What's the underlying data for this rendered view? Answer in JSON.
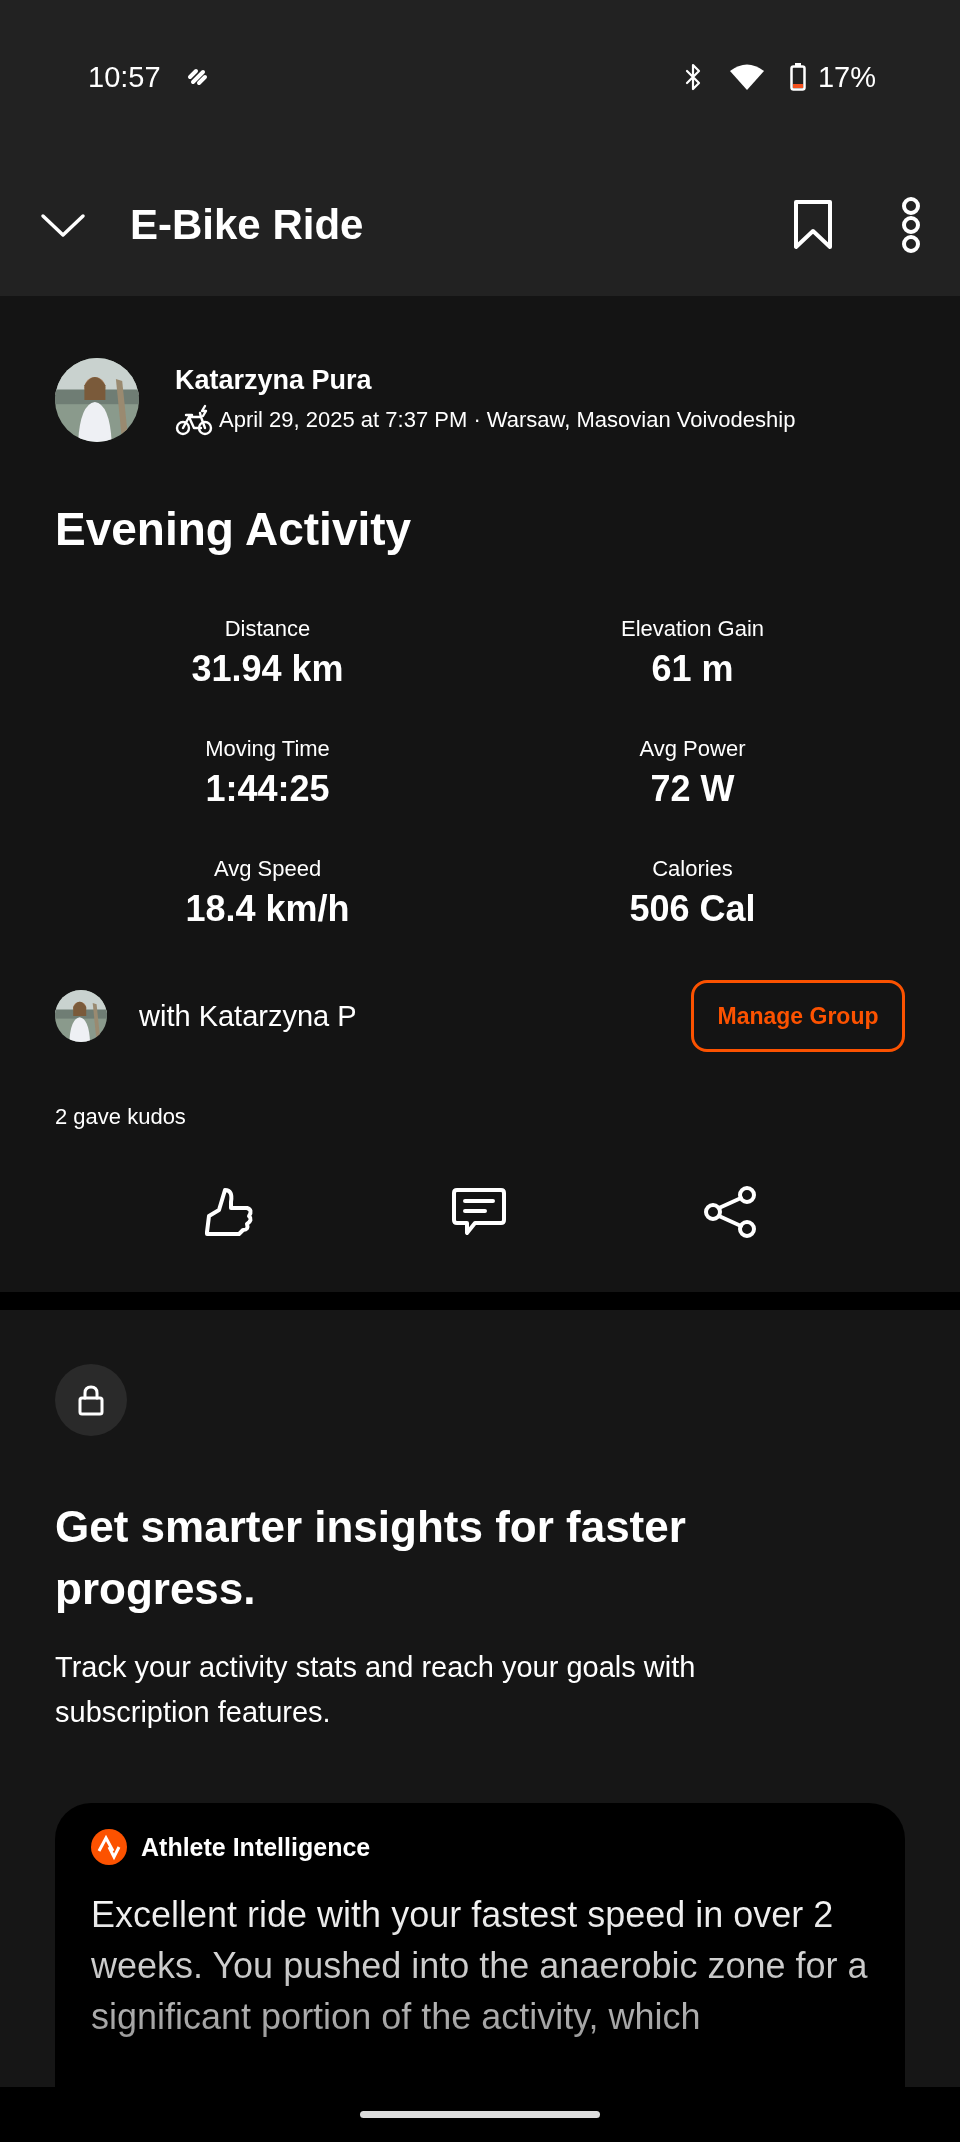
{
  "status_bar": {
    "time": "10:57",
    "battery": "17%"
  },
  "header": {
    "title": "E-Bike Ride"
  },
  "activity": {
    "athlete": "Katarzyna Pura",
    "meta": "April 29, 2025 at 7:37 PM · Warsaw, Masovian Voivodeship",
    "title": "Evening Activity",
    "stats": [
      {
        "label": "Distance",
        "value": "31.94 km"
      },
      {
        "label": "Elevation Gain",
        "value": "61 m"
      },
      {
        "label": "Moving Time",
        "value": "1:44:25"
      },
      {
        "label": "Avg Power",
        "value": "72 W"
      },
      {
        "label": "Avg Speed",
        "value": "18.4 km/h"
      },
      {
        "label": "Calories",
        "value": "506 Cal"
      }
    ],
    "group": {
      "text": "with Katarzyna P",
      "button": "Manage Group"
    },
    "kudos": "2 gave kudos"
  },
  "upsell": {
    "heading": "Get smarter insights for faster progress.",
    "text": "Track your activity stats and reach your goals with subscription features.",
    "card": {
      "title": "Athlete Intelligence",
      "body": "Excellent ride with your fastest speed in over 2 weeks. You pushed into the anaerobic zone for a significant portion of the activity, which"
    }
  }
}
